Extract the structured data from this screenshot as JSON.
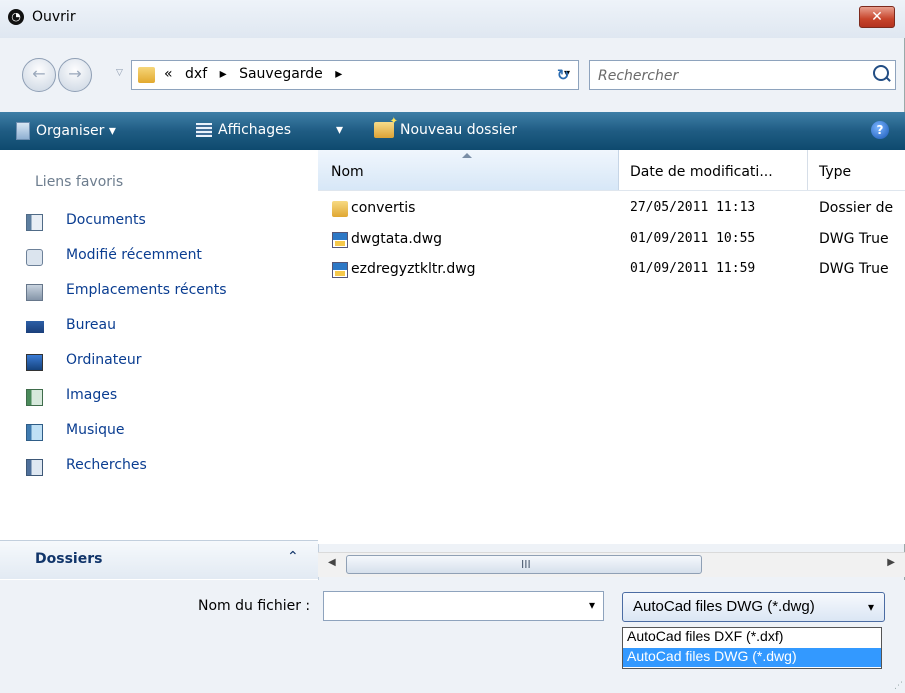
{
  "window": {
    "title": "Ouvrir",
    "close_label": "✕"
  },
  "address": {
    "path": [
      "«",
      "dxf",
      "▸",
      "Sauvegarde",
      "▸"
    ],
    "dropdown_glyph": "▾",
    "refresh_glyph": "↻"
  },
  "search": {
    "placeholder": "Rechercher"
  },
  "toolbar": {
    "organise_label": "Organiser ▾",
    "views_label": "Affichages",
    "views_arrow": "▾",
    "newfolder_label": "Nouveau dossier",
    "help_glyph": "?"
  },
  "sidebar": {
    "favorites_title": "Liens favoris",
    "items": [
      {
        "label": "Documents",
        "icon": "documents-icon"
      },
      {
        "label": "Modifié récemment",
        "icon": "recent-icon"
      },
      {
        "label": "Emplacements récents",
        "icon": "recent-places-icon"
      },
      {
        "label": "Bureau",
        "icon": "desktop-icon"
      },
      {
        "label": "Ordinateur",
        "icon": "computer-icon"
      },
      {
        "label": "Images",
        "icon": "pictures-icon"
      },
      {
        "label": "Musique",
        "icon": "music-icon"
      },
      {
        "label": "Recherches",
        "icon": "searches-icon"
      }
    ],
    "folders_label": "Dossiers",
    "collapse_glyph": "⌃"
  },
  "columns": {
    "name": "Nom",
    "date": "Date de modificati...",
    "type": "Type"
  },
  "files": [
    {
      "name": "convertis",
      "date": "27/05/2011 11:13",
      "type": "Dossier de",
      "icon": "folder-icon"
    },
    {
      "name": "dwgtata.dwg",
      "date": "01/09/2011 10:55",
      "type": "DWG True",
      "icon": "dwg-file-icon"
    },
    {
      "name": "ezdregyztkltr.dwg",
      "date": "01/09/2011 11:59",
      "type": "DWG True",
      "icon": "dwg-file-icon"
    }
  ],
  "scrollbar": {
    "left_glyph": "◀",
    "right_glyph": "▶",
    "grip": "III"
  },
  "bottom": {
    "filename_label": "Nom du fichier :",
    "filename_value": "",
    "filetype_selected": "AutoCad files DWG (*.dwg)",
    "filetype_options": [
      "AutoCad files DXF (*.dxf)",
      "AutoCad files DWG (*.dwg)"
    ],
    "dropdown_glyph": "▾"
  },
  "colors": {
    "toolbar": "#1f5c83",
    "link": "#0a3d91",
    "selection": "#3399ff",
    "close": "#c7442b"
  }
}
